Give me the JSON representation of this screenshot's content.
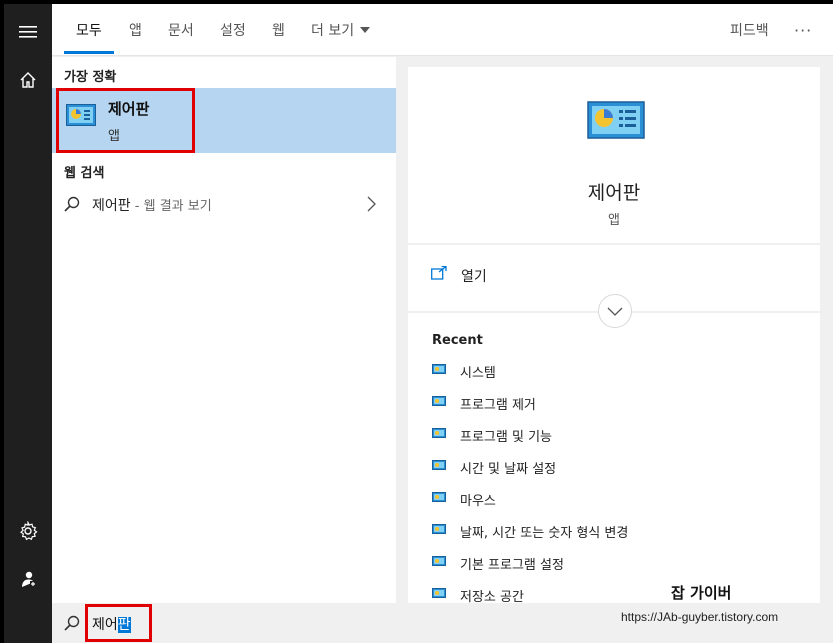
{
  "tabs": [
    {
      "label": "모두",
      "active": true
    },
    {
      "label": "앱"
    },
    {
      "label": "문서"
    },
    {
      "label": "설정"
    },
    {
      "label": "웹"
    },
    {
      "label": "더 보기"
    }
  ],
  "header": {
    "feedback_label": "피드백",
    "more_options": "···"
  },
  "rail_icons": [
    "hamburger-menu-icon",
    "home-icon",
    "settings-gear-icon",
    "user-account-icon"
  ],
  "best_match": {
    "section_label": "가장 정확",
    "title": "제어판",
    "subtitle": "앱",
    "icon": "control-panel-icon"
  },
  "web_search": {
    "section_label": "웹 검색",
    "query": "제어판",
    "hint": " - 웹 결과 보기"
  },
  "detail": {
    "title": "제어판",
    "subtitle": "앱",
    "open_label": "열기",
    "recent_header": "Recent",
    "recent_items": [
      "시스템",
      "프로그램 제거",
      "프로그램 및 기능",
      "시간 및 날짜 설정",
      "마우스",
      "날짜, 시간 또는 숫자 형식 변경",
      "기본 프로그램 설정",
      "저장소 공간"
    ]
  },
  "search": {
    "typed_text": "제어",
    "selected_text": "판"
  },
  "watermark": {
    "title": "잡 가이버",
    "url": "https://JAb-guyber.tistory.com"
  },
  "colors": {
    "accent": "#0078d7",
    "selection": "#b5d5f0",
    "highlight_box": "#e00000",
    "rail": "#1f1f1f"
  }
}
